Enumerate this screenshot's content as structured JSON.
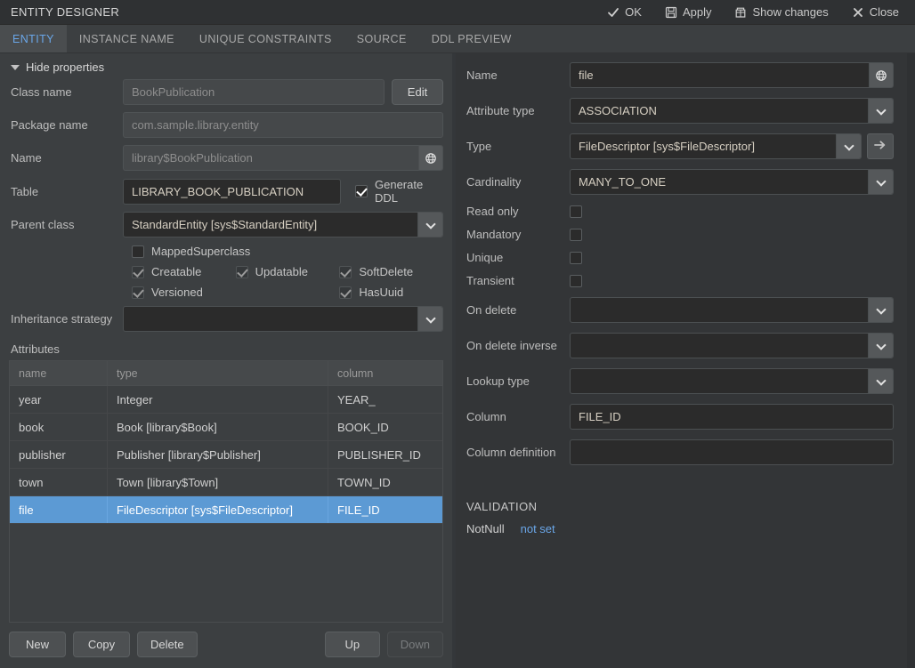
{
  "window": {
    "title": "ENTITY DESIGNER"
  },
  "toolbar": {
    "actions": [
      {
        "label": "OK",
        "icon": "check-icon"
      },
      {
        "label": "Apply",
        "icon": "save-icon"
      },
      {
        "label": "Show changes",
        "icon": "diff-icon"
      },
      {
        "label": "Close",
        "icon": "close-icon"
      }
    ]
  },
  "tabs": [
    {
      "label": "ENTITY",
      "active": true
    },
    {
      "label": "INSTANCE NAME",
      "active": false
    },
    {
      "label": "UNIQUE CONSTRAINTS",
      "active": false
    },
    {
      "label": "SOURCE",
      "active": false
    },
    {
      "label": "DDL PREVIEW",
      "active": false
    }
  ],
  "left": {
    "disclosure_label": "Hide properties",
    "fields": {
      "class_name_label": "Class name",
      "class_name_value": "BookPublication",
      "edit_button": "Edit",
      "package_name_label": "Package name",
      "package_name_value": "com.sample.library.entity",
      "name_label": "Name",
      "name_value": "library$BookPublication",
      "table_label": "Table",
      "table_value": "LIBRARY_BOOK_PUBLICATION",
      "generate_ddl_label": "Generate DDL",
      "generate_ddl_checked": true,
      "parent_class_label": "Parent class",
      "parent_class_value": "StandardEntity [sys$StandardEntity]",
      "inheritance_strategy_label": "Inheritance strategy",
      "inheritance_strategy_value": ""
    },
    "flags": [
      {
        "label": "MappedSuperclass",
        "checked": false,
        "dim": false
      },
      {
        "label": "Creatable",
        "checked": true,
        "dim": true
      },
      {
        "label": "Updatable",
        "checked": true,
        "dim": true
      },
      {
        "label": "SoftDelete",
        "checked": true,
        "dim": true
      },
      {
        "label": "Versioned",
        "checked": true,
        "dim": true
      },
      {
        "label": "HasUuid",
        "checked": true,
        "dim": true
      }
    ],
    "attributes_label": "Attributes",
    "grid": {
      "columns": [
        "name",
        "type",
        "column"
      ],
      "rows": [
        {
          "name": "year",
          "type": "Integer",
          "column": "YEAR_",
          "selected": false
        },
        {
          "name": "book",
          "type": "Book [library$Book]",
          "column": "BOOK_ID",
          "selected": false
        },
        {
          "name": "publisher",
          "type": "Publisher [library$Publisher]",
          "column": "PUBLISHER_ID",
          "selected": false
        },
        {
          "name": "town",
          "type": "Town [library$Town]",
          "column": "TOWN_ID",
          "selected": false
        },
        {
          "name": "file",
          "type": "FileDescriptor [sys$FileDescriptor]",
          "column": "FILE_ID",
          "selected": true
        }
      ]
    },
    "buttons": {
      "new": "New",
      "copy": "Copy",
      "delete": "Delete",
      "up": "Up",
      "down": "Down",
      "down_disabled": true
    }
  },
  "right": {
    "name_label": "Name",
    "name_value": "file",
    "attribute_type_label": "Attribute type",
    "attribute_type_value": "ASSOCIATION",
    "type_label": "Type",
    "type_value": "FileDescriptor [sys$FileDescriptor]",
    "cardinality_label": "Cardinality",
    "cardinality_value": "MANY_TO_ONE",
    "checkboxes": [
      {
        "label": "Read only",
        "checked": false
      },
      {
        "label": "Mandatory",
        "checked": false
      },
      {
        "label": "Unique",
        "checked": false
      },
      {
        "label": "Transient",
        "checked": false
      }
    ],
    "on_delete_label": "On delete",
    "on_delete_value": "",
    "on_delete_inverse_label": "On delete inverse",
    "on_delete_inverse_value": "",
    "lookup_type_label": "Lookup type",
    "lookup_type_value": "",
    "column_label": "Column",
    "column_value": "FILE_ID",
    "column_definition_label": "Column definition",
    "column_definition_value": "",
    "validation_title": "VALIDATION",
    "validation_rows": [
      {
        "name": "NotNull",
        "state": "not set"
      }
    ]
  },
  "colors": {
    "accent_blue": "#6aa6e8",
    "selection_blue": "#5c9ad4",
    "window_bg": "#3c3f41",
    "field_bg": "#2b2b2b"
  }
}
